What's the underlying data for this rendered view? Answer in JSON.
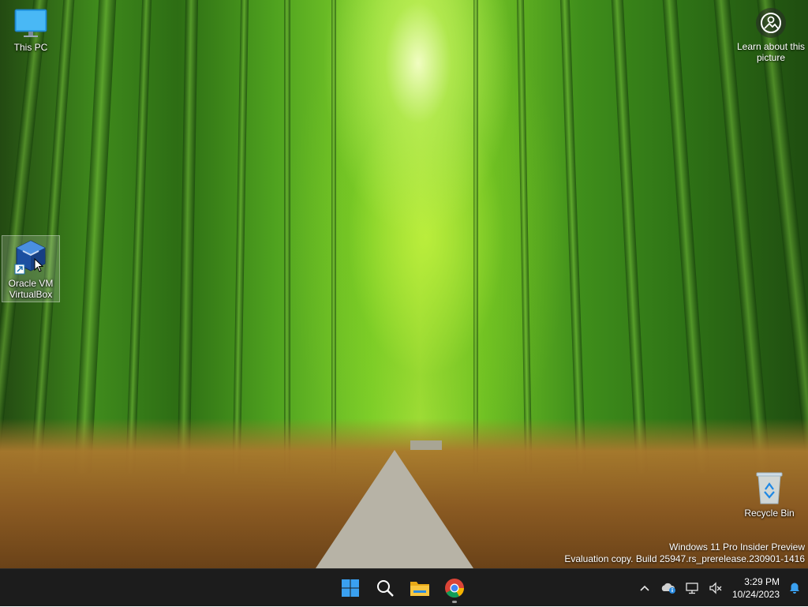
{
  "desktop": {
    "icons": [
      {
        "name": "this-pc",
        "label": "This PC"
      },
      {
        "name": "virtualbox",
        "label": "Oracle VM VirtualBox"
      },
      {
        "name": "recycle-bin",
        "label": "Recycle Bin"
      }
    ],
    "learn_picture": "Learn about this picture",
    "watermark": {
      "line1": "Windows 11 Pro Insider Preview",
      "line2": "Evaluation copy. Build 25947.rs_prerelease.230901-1416"
    }
  },
  "taskbar": {
    "apps": [
      {
        "name": "start",
        "icon": "windows-logo-icon"
      },
      {
        "name": "search",
        "icon": "search-icon"
      },
      {
        "name": "file-explorer",
        "icon": "folder-icon"
      },
      {
        "name": "chrome",
        "icon": "chrome-icon",
        "running": true
      }
    ],
    "tray": {
      "icons": [
        "chevron-up-icon",
        "onedrive-icon",
        "network-icon",
        "volume-muted-icon"
      ],
      "time": "3:29 PM",
      "date": "10/24/2023",
      "notification_icon": "bell-icon"
    }
  },
  "colors": {
    "taskbar_bg": "#1c1c1c",
    "accent": "#0078d4"
  }
}
